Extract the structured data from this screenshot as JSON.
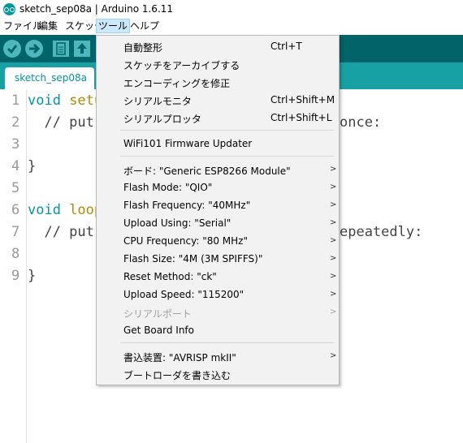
{
  "window": {
    "title": "sketch_sep08a | Arduino 1.6.11",
    "icon": "arduino-logo-icon"
  },
  "menubar": {
    "file": "ファイル",
    "edit": "編集",
    "sketch": "スケッチ",
    "tools": "ツール",
    "help": "ヘルプ"
  },
  "toolbar": {
    "verify_icon": "check-icon",
    "upload_icon": "arrow-right-icon",
    "new_icon": "new-file-icon",
    "open_icon": "arrow-up-icon"
  },
  "tab": {
    "label": "sketch_sep08a"
  },
  "editor": {
    "line_numbers": [
      "1",
      "2",
      "3",
      "4",
      "5",
      "6",
      "7",
      "8",
      "9"
    ],
    "lines": {
      "l1_kw": "void",
      "l1_fn": " setu",
      "l2": "  // put",
      "l2_tail": "once:",
      "l4": "}",
      "l6_kw": "void",
      "l6_fn": " loop",
      "l7": "  // put",
      "l7_tail": "epeatedly:",
      "l9": "}"
    }
  },
  "tools_menu": {
    "auto_format": {
      "label": "自動整形",
      "shortcut": "Ctrl+T"
    },
    "archive_sketch": {
      "label": "スケッチをアーカイブする"
    },
    "fix_encoding": {
      "label": "エンコーディングを修正"
    },
    "serial_monitor": {
      "label": "シリアルモニタ",
      "shortcut": "Ctrl+Shift+M"
    },
    "serial_plotter": {
      "label": "シリアルプロッタ",
      "shortcut": "Ctrl+Shift+L"
    },
    "wifi_updater": {
      "label": "WiFi101 Firmware Updater"
    },
    "board": {
      "label": "ボード: \"Generic ESP8266 Module\""
    },
    "flash_mode": {
      "label": "Flash Mode: \"QIO\""
    },
    "flash_frequency": {
      "label": "Flash Frequency: \"40MHz\""
    },
    "upload_using": {
      "label": "Upload Using: \"Serial\""
    },
    "cpu_frequency": {
      "label": "CPU Frequency: \"80 MHz\""
    },
    "flash_size": {
      "label": "Flash Size: \"4M (3M SPIFFS)\""
    },
    "reset_method": {
      "label": "Reset Method: \"ck\""
    },
    "upload_speed": {
      "label": "Upload Speed: \"115200\""
    },
    "serial_port": {
      "label": "シリアルポート"
    },
    "board_info": {
      "label": "Get Board Info"
    },
    "programmer": {
      "label": "書込装置: \"AVRISP mkII\""
    },
    "burn_bootloader": {
      "label": "ブートローダを書き込む"
    },
    "submenu_arrow": ">"
  },
  "colors": {
    "toolbar_bg": "#006468",
    "tabbar_bg": "#17a1a5",
    "accent": "#00979c"
  }
}
